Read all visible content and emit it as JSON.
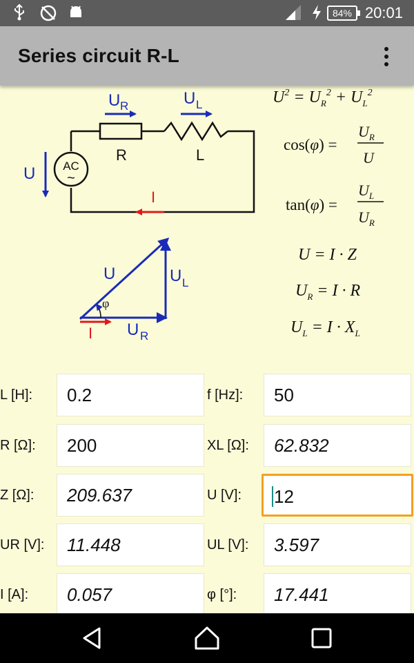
{
  "status_bar": {
    "battery": "84%",
    "time": "20:01",
    "icons": [
      "usb-icon",
      "sync-off-icon",
      "android-icon",
      "signal-icon",
      "charging-icon",
      "battery-icon"
    ]
  },
  "app_bar": {
    "title": "Series circuit R-L",
    "menu_icon": "more-vert-icon"
  },
  "circuit": {
    "ur_label": "U",
    "ur_sub": "R",
    "ul_label": "U",
    "ul_sub": "L",
    "r_label": "R",
    "l_label": "L",
    "u_label": "U",
    "source_label": "AC",
    "source_symbol": "~",
    "i_label": "I"
  },
  "phasor": {
    "u_label": "U",
    "ul_label": "U",
    "ul_sub": "L",
    "ur_label": "U",
    "ur_sub": "R",
    "phi_label": "φ",
    "i_label": "I"
  },
  "formulas": {
    "f1": "U² = U_R² + U_L²",
    "f2": "cos(φ) = U_R / U",
    "f3": "tan(φ) = U_L / U_R",
    "f4": "U = I · Z",
    "f5": "U_R = I · R",
    "f6": "U_L = I · X_L"
  },
  "fields": {
    "L": {
      "label": "L [H]:",
      "value": "0.2"
    },
    "f": {
      "label": "f [Hz]:",
      "value": "50"
    },
    "R": {
      "label": "R [Ω]:",
      "value": "200"
    },
    "XL": {
      "label": "XL [Ω]:",
      "value": "62.832"
    },
    "Z": {
      "label": "Z [Ω]:",
      "value": "209.637"
    },
    "U": {
      "label": "U [V]:",
      "value": "12"
    },
    "UR": {
      "label": "UR [V]:",
      "value": "11.448"
    },
    "UL": {
      "label": "UL [V]:",
      "value": "3.597"
    },
    "I": {
      "label": "I [A]:",
      "value": "0.057"
    },
    "phi": {
      "label": "φ [°]:",
      "value": "17.441"
    }
  },
  "colors": {
    "accent_focus": "#f2a020",
    "arrow_blue": "#1a2bb8",
    "arrow_red": "#e01a1a",
    "background": "#fbfbd8"
  },
  "nav_bar": {
    "back": "back-icon",
    "home": "home-icon",
    "recents": "recents-icon"
  }
}
